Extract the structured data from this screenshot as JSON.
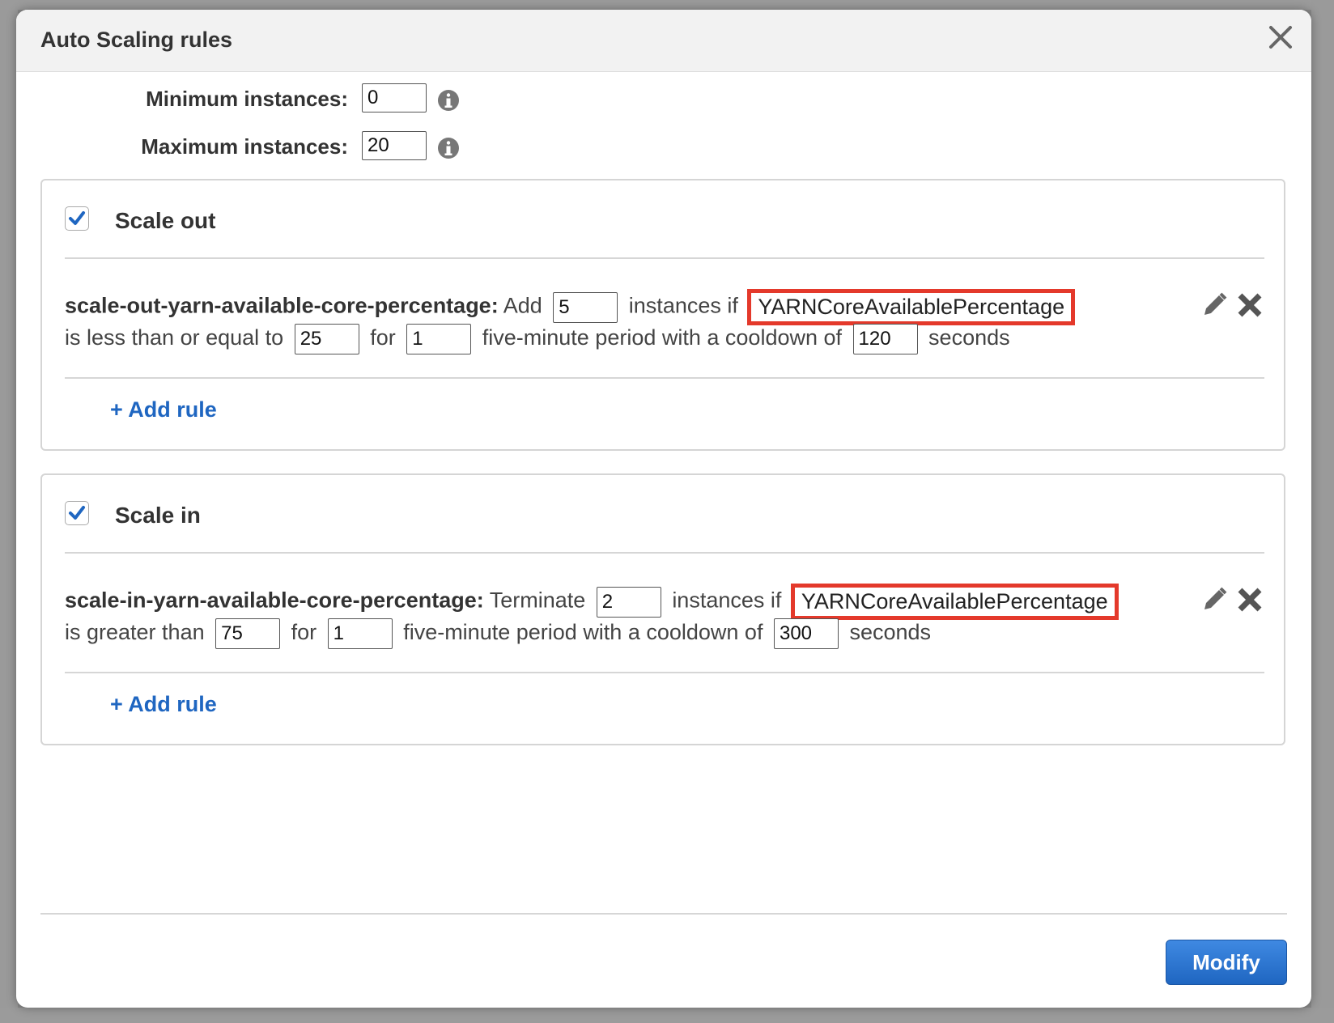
{
  "dialog": {
    "title": "Auto Scaling rules",
    "close_icon": "close-icon"
  },
  "limits": {
    "min_label": "Minimum instances:",
    "min_value": "0",
    "max_label": "Maximum instances:",
    "max_value": "20",
    "info_icon": "info-icon"
  },
  "scale_out": {
    "title": "Scale out",
    "checked": true,
    "rule": {
      "name": "scale-out-yarn-available-core-percentage:",
      "action": "Add",
      "count": "5",
      "instances_text": "instances if",
      "metric": "YARNCoreAvailablePercentage",
      "condition": "is less than or equal to",
      "threshold": "25",
      "for_text": "for",
      "periods": "1",
      "period_text": "five-minute period",
      "cooldown_text": "with a cooldown of",
      "cooldown": "120",
      "seconds_text": "seconds"
    },
    "add_rule_label": "+ Add rule"
  },
  "scale_in": {
    "title": "Scale in",
    "checked": true,
    "rule": {
      "name": "scale-in-yarn-available-core-percentage:",
      "action": "Terminate",
      "count": "2",
      "instances_text": "instances if",
      "metric": "YARNCoreAvailablePercentage",
      "condition": "is greater than",
      "threshold": "75",
      "for_text": "for",
      "periods": "1",
      "period_text": "five-minute period",
      "cooldown_text": "with a cooldown of",
      "cooldown": "300",
      "seconds_text": "seconds"
    },
    "add_rule_label": "+ Add rule"
  },
  "footer": {
    "modify_label": "Modify"
  },
  "colors": {
    "accent": "#1f66c1",
    "highlight": "#e4392b"
  }
}
